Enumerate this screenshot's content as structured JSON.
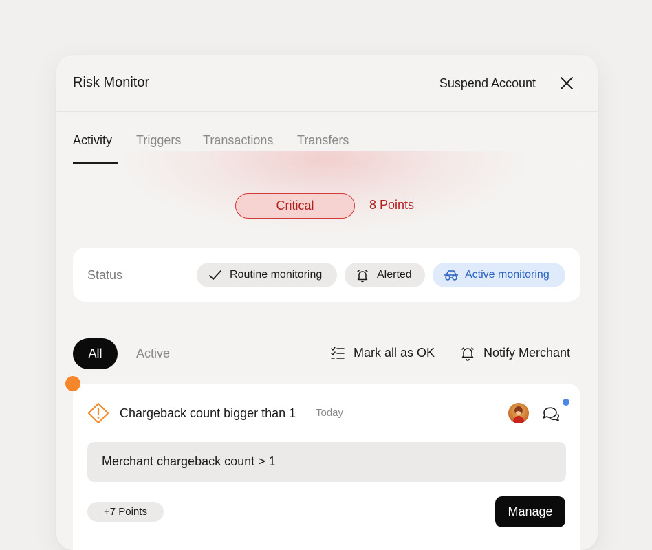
{
  "header": {
    "title": "Risk Monitor",
    "suspend_label": "Suspend Account"
  },
  "tabs": [
    {
      "label": "Activity",
      "active": true
    },
    {
      "label": "Triggers",
      "active": false
    },
    {
      "label": "Transactions",
      "active": false
    },
    {
      "label": "Transfers",
      "active": false
    }
  ],
  "risk": {
    "level": "Critical",
    "points": "8 Points"
  },
  "status": {
    "label": "Status",
    "chips": [
      {
        "label": "Routine monitoring",
        "icon": "check-icon",
        "active": false
      },
      {
        "label": "Alerted",
        "icon": "bell-icon",
        "active": false
      },
      {
        "label": "Active monitoring",
        "icon": "binoculars-icon",
        "active": true
      }
    ]
  },
  "filters": {
    "all": "All",
    "active": "Active",
    "mark_all_ok": "Mark all as OK",
    "notify_merchant": "Notify Merchant"
  },
  "alert": {
    "title": "Chargeback count bigger than 1",
    "date": "Today",
    "condition": "Merchant chargeback count > 1",
    "points": "+7 Points",
    "manage_label": "Manage"
  },
  "colors": {
    "critical": "#d33a3a",
    "warning": "#f5862a",
    "active_chip": "#2b62c2",
    "unread_dot": "#4b86e8"
  }
}
